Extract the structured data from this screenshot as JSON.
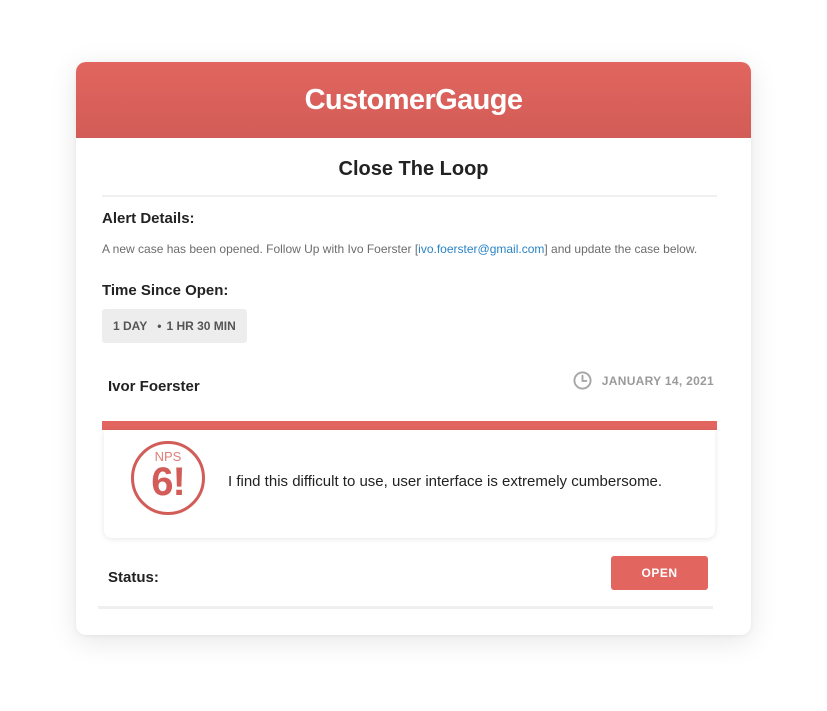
{
  "header": {
    "brand": "CustomerGauge",
    "brand_color": "#e2655f"
  },
  "title": "Close The Loop",
  "alert": {
    "label": "Alert Details:",
    "text_before": "A new case has been opened. Follow Up with Ivo Foerster [",
    "email": "ivo.foerster@gmail.com",
    "text_after": "] and update the case below."
  },
  "time_since_open": {
    "label": "Time Since Open:",
    "days": "1 DAY",
    "separator": "•",
    "hours": "1 HR 30 MIN"
  },
  "customer": {
    "name": "Ivor Foerster",
    "date": "JANUARY 14, 2021",
    "date_icon": "clock-icon"
  },
  "response": {
    "nps_label": "NPS",
    "nps_score": "6!",
    "comment": "I find this difficult to use, user interface is extremely cumbersome."
  },
  "status": {
    "label": "Status:",
    "button": "OPEN"
  }
}
